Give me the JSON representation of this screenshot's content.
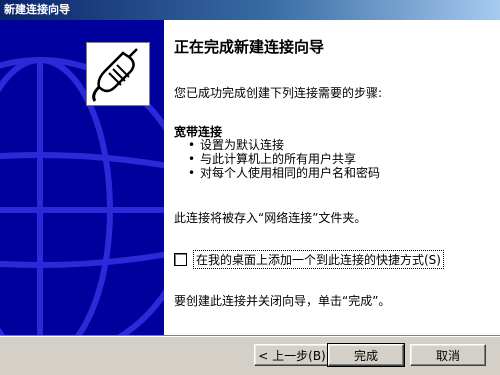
{
  "window": {
    "title": "新建连接向导"
  },
  "wizard": {
    "title": "正在完成新建连接向导",
    "intro": "您已成功完成创建下列连接需要的步骤:",
    "section_title": "宽带连接",
    "bullets": [
      "设置为默认连接",
      "与此计算机上的所有用户共享",
      "对每个人使用相同的用户名和密码"
    ],
    "note": "此连接将被存入“网络连接”文件夹。",
    "checkbox": {
      "label": "在我的桌面上添加一个到此连接的快捷方式(S)",
      "checked": false
    },
    "finish_note": "要创建此连接并关闭向导，单击“完成”。"
  },
  "buttons": {
    "back": "< 上一步(B)",
    "finish": "完成",
    "cancel": "取消"
  },
  "colors": {
    "title_start": "#0a246a",
    "title_end": "#a6caf0",
    "panel": "#00009c",
    "globe_lines": "#2a2ad8"
  },
  "icons": {
    "logo": "network-cable-icon"
  }
}
